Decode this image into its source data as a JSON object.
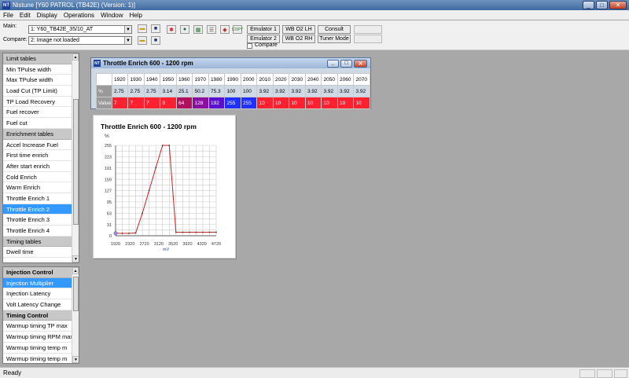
{
  "window": {
    "title": "Nistune [Y60 PATROL (TB42E) (Version: 1)]",
    "icon": "NT"
  },
  "menu": [
    "File",
    "Edit",
    "Display",
    "Operations",
    "Window",
    "Help"
  ],
  "toolbar": {
    "main_label": "Main:",
    "main_value": "1: Y60_TB42E_35/10_AT",
    "compare_label": "Compare:",
    "compare_value": "2: Image not loaded",
    "emulator1": "Emulator 1",
    "emulator2": "Emulator 2",
    "compare_check": "Compare",
    "wb_o2_lh": "WB O2 LH",
    "wb_o2_rh": "WB O2 RH",
    "consult": "Consult",
    "tuner_mode": "Tuner Mode",
    "copy_icon_label": "COPY"
  },
  "upper_list": [
    {
      "label": "Limit tables",
      "type": "head"
    },
    {
      "label": "Min TPulse width"
    },
    {
      "label": "Max TPulse width"
    },
    {
      "label": "Load Cut (TP Limit)"
    },
    {
      "label": "TP Load Recovery"
    },
    {
      "label": "Fuel recover"
    },
    {
      "label": "Fuel cut"
    },
    {
      "label": "Enrichment tables",
      "type": "head"
    },
    {
      "label": "Accel Increase Fuel"
    },
    {
      "label": "First time enrich"
    },
    {
      "label": "After start enrich"
    },
    {
      "label": "Cold Enrich"
    },
    {
      "label": "Warm Enrich"
    },
    {
      "label": "Throttle Enrich 1"
    },
    {
      "label": "Throttle Enrich 2",
      "type": "sel"
    },
    {
      "label": "Throttle Enrich 3"
    },
    {
      "label": "Throttle Enrich 4"
    },
    {
      "label": "Timing tables",
      "type": "head"
    },
    {
      "label": "Dwell time"
    }
  ],
  "lower_list": [
    {
      "label": "Injection Control",
      "type": "head"
    },
    {
      "label": "Injection Multiplier",
      "type": "sel"
    },
    {
      "label": "Injection Latency"
    },
    {
      "label": "Volt Latency Change"
    },
    {
      "label": "Timing Control",
      "type": "head"
    },
    {
      "label": "Warmup timing TP max"
    },
    {
      "label": "Warmup timing RPM max"
    },
    {
      "label": "Warmup timing temp m"
    },
    {
      "label": "Warmup timing temp m"
    }
  ],
  "table_window": {
    "title": "Throttle Enrich 600 - 1200 rpm",
    "row_headers": [
      "mV",
      "%",
      "Value"
    ],
    "mv": [
      "1920",
      "1930",
      "1940",
      "1950",
      "1960",
      "1970",
      "1980",
      "1990",
      "2000",
      "2010",
      "2020",
      "2030",
      "2040",
      "2050",
      "2060",
      "2070"
    ],
    "pct": [
      "2.75",
      "2.75",
      "2.75",
      "3.14",
      "25.1",
      "50.2",
      "75.3",
      "100",
      "100",
      "3.92",
      "3.92",
      "3.92",
      "3.92",
      "3.92",
      "3.92",
      "3.92"
    ],
    "value": [
      "7",
      "7",
      "7",
      "8",
      "64",
      "128",
      "192",
      "255",
      "255",
      "10",
      "10",
      "10",
      "10",
      "10",
      "10",
      "10"
    ],
    "value_colors": [
      "#ff2030",
      "#ff2030",
      "#ff2030",
      "#ff2030",
      "#b01060",
      "#8a10a0",
      "#5a10d0",
      "#2030ff",
      "#2030ff",
      "#ff2030",
      "#ff2030",
      "#ff2030",
      "#ff2030",
      "#ff2030",
      "#ff2030",
      "#ff2030"
    ]
  },
  "chart_data": {
    "type": "line",
    "title": "Throttle Enrich 600 - 1200 rpm",
    "xlabel": "mV",
    "ylabel": "%",
    "x": [
      1920,
      2320,
      2720,
      3120,
      3520,
      3920,
      4320,
      4720
    ],
    "y_ticks": [
      0,
      31,
      63,
      95,
      127,
      159,
      191,
      223,
      255
    ],
    "x_tick_labels": [
      "1920",
      "2320",
      "2720",
      "3120",
      "3520",
      "3920",
      "4320",
      "4720"
    ],
    "series": [
      {
        "values": [
          7,
          7,
          7,
          8,
          64,
          128,
          192,
          255,
          255,
          10,
          10,
          10,
          10,
          10,
          10,
          10
        ]
      }
    ],
    "ylim": [
      0,
      255
    ],
    "grid": true,
    "line_color": "#cc2020"
  },
  "status": {
    "text": "Ready"
  }
}
